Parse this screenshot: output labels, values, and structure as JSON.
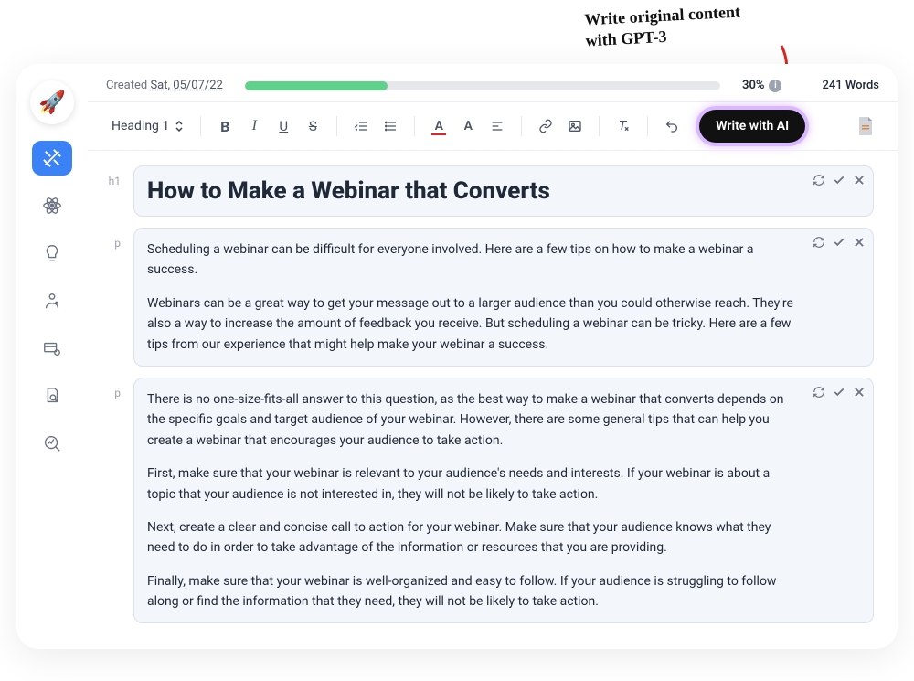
{
  "annotation": {
    "text": "Write original content\nwith GPT-3"
  },
  "header": {
    "created_label": "Created",
    "created_date": "Sat, 05/07/22",
    "progress_percent": 30,
    "progress_label": "30%",
    "word_count": "241 Words"
  },
  "toolbar": {
    "heading_select": "Heading 1",
    "write_ai_label": "Write with AI"
  },
  "sidebar": {
    "logo_emoji": "🚀"
  },
  "blocks": [
    {
      "tag": "h1",
      "type": "heading",
      "text": "How to Make a Webinar that Converts"
    },
    {
      "tag": "p",
      "type": "paragraph",
      "paragraphs": [
        "Scheduling a webinar can be difficult for everyone involved. Here are a few tips on how to make a webinar a success.",
        "Webinars can be a great way to get your message out to a larger audience than you could otherwise reach. They're also a way to increase the amount of feedback you receive. But scheduling a webinar can be tricky. Here are a few tips from our experience that might help make your webinar a success."
      ]
    },
    {
      "tag": "p",
      "type": "paragraph",
      "paragraphs": [
        "There is no one-size-fits-all answer to this question, as the best way to make a webinar that converts depends on the specific goals and target audience of your webinar. However, there are some general tips that can help you create a webinar that encourages your audience to take action.",
        "First, make sure that your webinar is relevant to your audience's needs and interests. If your webinar is about a topic that your audience is not interested in, they will not be likely to take action.",
        "Next, create a clear and concise call to action for your webinar. Make sure that your audience knows what they need to do in order to take advantage of the information or resources that you are providing.",
        "Finally, make sure that your webinar is well-organized and easy to follow. If your audience is struggling to follow along or find the information that they need, they will not be likely to take action."
      ]
    }
  ]
}
